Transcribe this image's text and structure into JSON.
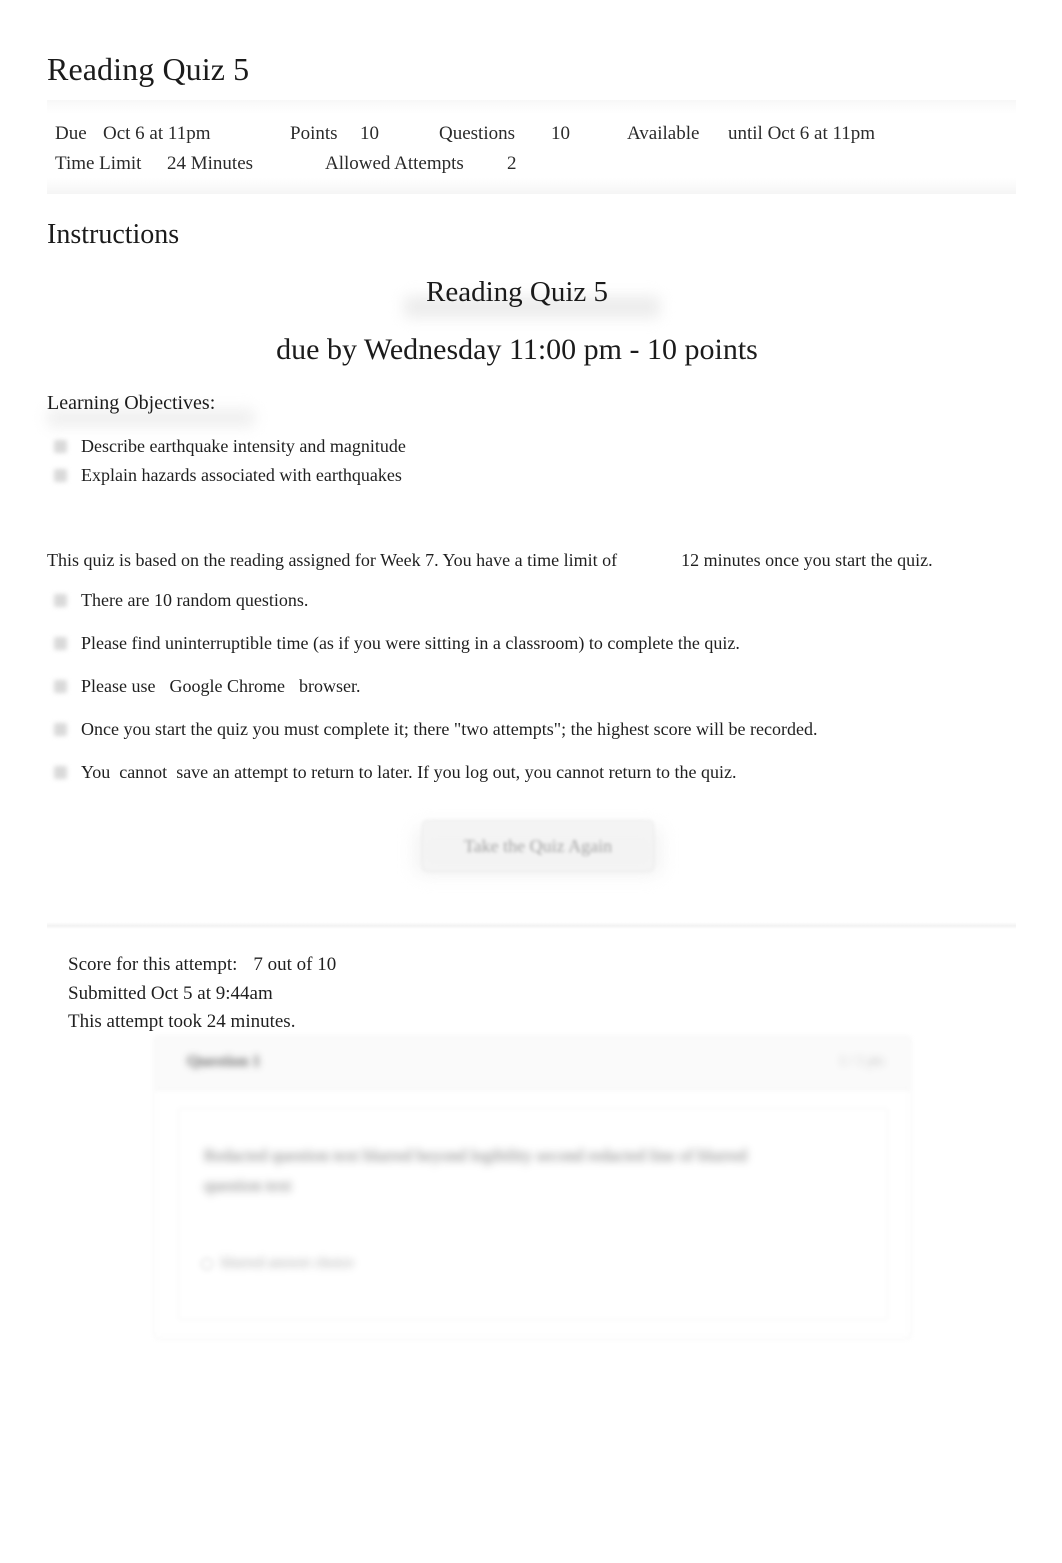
{
  "page": {
    "title": "Reading Quiz 5"
  },
  "meta": {
    "due_label": "Due",
    "due_value": "Oct 6 at 11pm",
    "points_label": "Points",
    "points_value": "10",
    "questions_label": "Questions",
    "questions_value": "10",
    "available_label": "Available",
    "available_value": "until Oct 6 at 11pm",
    "time_limit_label": "Time Limit",
    "time_limit_value": "24 Minutes",
    "allowed_attempts_label": "Allowed Attempts",
    "allowed_attempts_value": "2"
  },
  "instructions": {
    "heading": "Instructions",
    "quiz_heading": "Reading Quiz 5",
    "due_heading": "due by Wednesday 11:00 pm - 10 points",
    "objectives_heading": "Learning Objectives:",
    "objectives": [
      "Describe earthquake intensity and magnitude",
      "Explain hazards associated with earthquakes"
    ],
    "intro_part1": "This quiz is based on the reading assigned for Week 7. You have a time limit of",
    "intro_part2": "12 minutes once you start the quiz.",
    "notes": [
      {
        "text": "There are 10 random questions."
      },
      {
        "text": "Please find uninterruptible time (as if you were sitting in a classroom) to complete the quiz."
      },
      {
        "text": "Once you start the quiz you must complete it; there \"two attempts\"; the highest score will be recorded."
      }
    ],
    "browser_note": {
      "prefix": "Please use",
      "link": "Google Chrome",
      "suffix": "browser."
    },
    "cannot_note": {
      "a": "You",
      "b": "cannot",
      "c": "save an attempt to return to later. If you log out, you cannot return to the quiz."
    }
  },
  "actions": {
    "retake_label": "Take the Quiz Again"
  },
  "attempt": {
    "score_label": "Score for this attempt:",
    "score_value": "7",
    "score_out_of": "out of 10",
    "submitted": "Submitted Oct 5 at 9:44am",
    "duration": "This attempt took 24 minutes."
  },
  "question_card": {
    "question_label": "Question 1",
    "points": "1 / 1 pts",
    "prompt_line1": "Redacted question text blurred beyond legibility",
    "prompt_line2": "second redacted line of blurred question text",
    "answer": "blurred answer choice"
  }
}
